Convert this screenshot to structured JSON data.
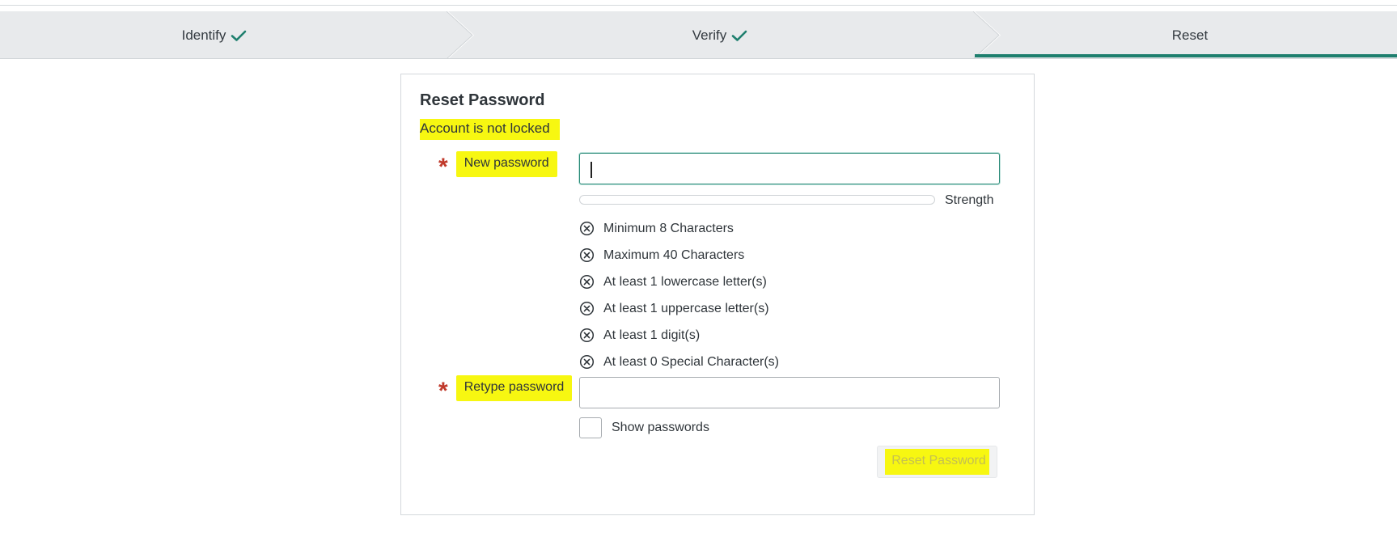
{
  "stepper": {
    "steps": [
      {
        "label": "Identify",
        "done": true
      },
      {
        "label": "Verify",
        "done": true
      },
      {
        "label": "Reset",
        "done": false,
        "active": true
      }
    ]
  },
  "form": {
    "title": "Reset Password",
    "status": "Account is not locked",
    "new_password_label": "New password",
    "new_password_value": "",
    "strength_label": "Strength",
    "strength_level": 0,
    "rules": [
      {
        "text": "Minimum 8 Characters",
        "met": false
      },
      {
        "text": "Maximum 40 Characters",
        "met": false
      },
      {
        "text": "At least 1 lowercase letter(s)",
        "met": false
      },
      {
        "text": "At least 1 uppercase letter(s)",
        "met": false
      },
      {
        "text": "At least 1 digit(s)",
        "met": false
      },
      {
        "text": "At least 0 Special Character(s)",
        "met": false
      }
    ],
    "retype_password_label": "Retype password",
    "retype_password_value": "",
    "show_passwords_label": "Show passwords",
    "show_passwords_checked": false,
    "submit_label": "Reset Password",
    "submit_enabled": false
  },
  "colors": {
    "accent": "#1e7f6e",
    "required": "#c0392b",
    "highlight": "#f7f711"
  },
  "icons": {
    "done": "check-icon",
    "rule_unmet": "circle-x-icon",
    "required": "asterisk-icon"
  }
}
